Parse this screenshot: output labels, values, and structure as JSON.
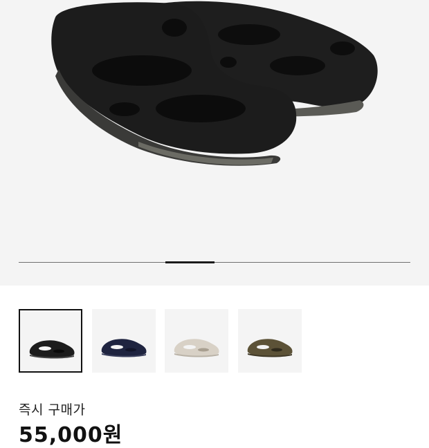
{
  "gallery": {
    "current_slide": 5,
    "total_slides": 8,
    "thumbnails": [
      {
        "color_name": "black",
        "color": "#1c1c1c",
        "sole": "#444444",
        "selected": true
      },
      {
        "color_name": "navy",
        "color": "#1f2440",
        "sole": "#3a3f5c",
        "selected": false
      },
      {
        "color_name": "beige",
        "color": "#d8d1c6",
        "sole": "#b9b2a6",
        "selected": false
      },
      {
        "color_name": "olive",
        "color": "#5c5237",
        "sole": "#3f3826",
        "selected": false
      }
    ]
  },
  "product": {
    "price_label": "즉시 구매가",
    "price": "55,000원"
  },
  "colors": {
    "hero_background": "#f4f4f4",
    "shoe": "#1c1c1c",
    "progress_thumb": "#1a1a1a"
  }
}
